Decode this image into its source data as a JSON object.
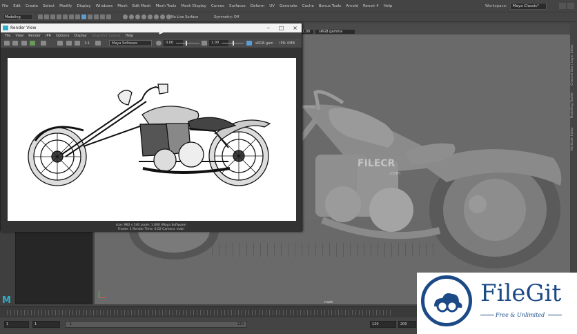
{
  "menubar": {
    "items": [
      "File",
      "Edit",
      "Create",
      "Select",
      "Modify",
      "Display",
      "Windows",
      "Mesh",
      "Edit Mesh",
      "Mesh Tools",
      "Mesh Display",
      "Curves",
      "Surfaces",
      "Deform",
      "UV",
      "Generate",
      "Cache",
      "Bonus Tools",
      "Arnold",
      "Renoir 4",
      "Help"
    ],
    "workspace_label": "Workspace:",
    "workspace_value": "Maya Classic*"
  },
  "toolbar": {
    "mode": "Modeling",
    "live_surface": "No Live Surface",
    "symmetry": "Symmetry: Off"
  },
  "render_view": {
    "title": "Render View",
    "menu": [
      "File",
      "View",
      "Render",
      "IPR",
      "Options",
      "Display",
      "Snapshot Layout",
      "Help"
    ],
    "ratio": "1:1",
    "renderer": "Maya Software",
    "exposure": "0.00",
    "gamma": "1.00",
    "color_space": "sRGB gam",
    "ipr_label": "IPR: 0MB",
    "status_line1": "size: 960 x 540  zoom: 1.000          (Maya Software)",
    "status_line2": "Frame: 1     Render Time: 0:02          Camera: main"
  },
  "viewport": {
    "exposure_val": "1.00",
    "color_space": "sRGB gamma",
    "camera_label": "main",
    "watermark": "FILECR",
    "watermark_sub": ".com",
    "right_tabs": [
      "Channel Box / Layer Editor",
      "Modelling Toolkit",
      "Attribute Editor"
    ]
  },
  "range": {
    "start": "1",
    "playback_start": "1",
    "slider_start": "1",
    "slider_end": "120",
    "playback_end": "120",
    "end": "200"
  },
  "badge": {
    "title": "FileGit",
    "subtitle": "Free & Unlimited",
    "brand_color": "#1b4a86"
  },
  "colors": {
    "maya_accent": "#2fb0c8",
    "highlight": "#5d9bd0"
  }
}
